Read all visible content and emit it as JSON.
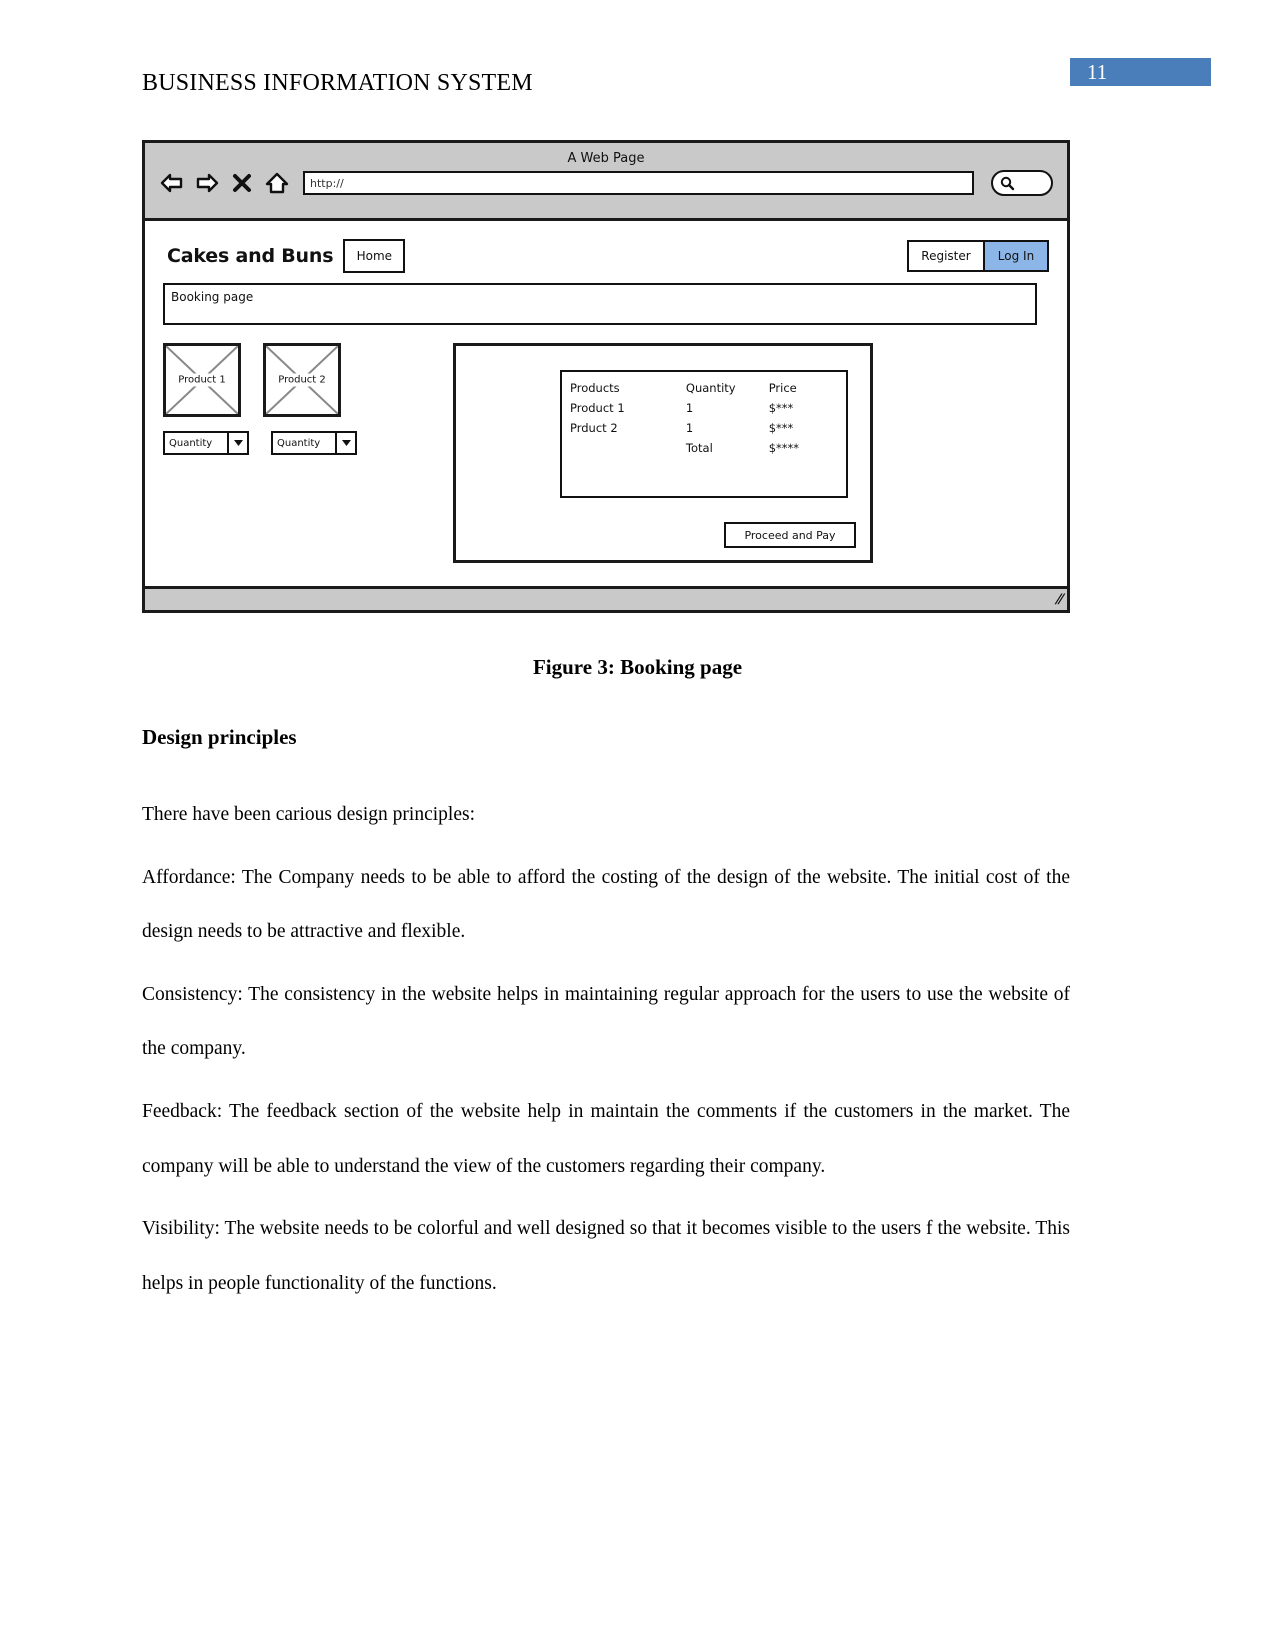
{
  "document": {
    "running_header": "BUSINESS INFORMATION SYSTEM",
    "page_number": "11",
    "page_badge_color": "#4a7ebb",
    "caption": "Figure 3: Booking page"
  },
  "wireframe": {
    "browser": {
      "window_title": "A Web Page",
      "url_value": "http://",
      "icons": {
        "back": "back-arrow-icon",
        "forward": "forward-arrow-icon",
        "stop": "close-x-icon",
        "home": "home-icon",
        "search": "search-icon"
      }
    },
    "site": {
      "brand": "Cakes and Buns",
      "nav": {
        "home": "Home",
        "register": "Register",
        "login": "Log In",
        "login_highlight_color": "#8cb6e8"
      },
      "page_title": "Booking page",
      "products": [
        {
          "image_label": "Product 1",
          "quantity_label": "Quantity"
        },
        {
          "image_label": "Product 2",
          "quantity_label": "Quantity"
        }
      ],
      "order_summary": {
        "headers": [
          "Products",
          "Quantity",
          "Price"
        ],
        "rows": [
          [
            "Product 1",
            "1",
            "$***"
          ],
          [
            "Prduct 2",
            "1",
            "$***"
          ]
        ],
        "total_label": "Total",
        "total_value": "$****"
      },
      "proceed_button": "Proceed and Pay"
    }
  },
  "content": {
    "heading": "Design principles",
    "paragraphs": [
      "There have been carious design principles:",
      "Affordance: The Company needs to be able to afford the costing of the design of the website. The initial cost of the design needs to be attractive and flexible.",
      "Consistency: The consistency in the website helps in maintaining regular approach for the users to use the website of the company.",
      "Feedback: The feedback section of the website help in maintain the comments if the customers in the market.  The company will be able to understand the view of the customers regarding their company.",
      "Visibility: The website needs to be colorful and well designed so that it becomes visible to the users f the website.  This helps in people functionality of the functions."
    ]
  }
}
